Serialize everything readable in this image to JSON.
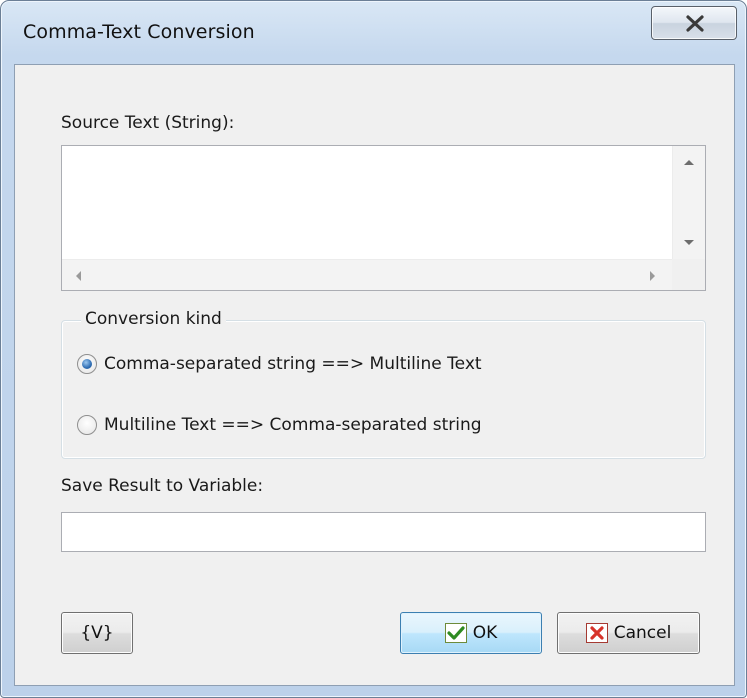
{
  "window": {
    "title": "Comma-Text Conversion",
    "close_glyph": "✕"
  },
  "source": {
    "label": "Source Text (String):",
    "value": ""
  },
  "conversion": {
    "legend": "Conversion kind",
    "options": [
      {
        "label": "Comma-separated string ==> Multiline Text",
        "selected": true
      },
      {
        "label": "Multiline Text ==> Comma-separated string",
        "selected": false
      }
    ]
  },
  "result": {
    "label": "Save Result to Variable:",
    "value": ""
  },
  "buttons": {
    "variables": "{V}",
    "ok": "OK",
    "cancel": "Cancel"
  },
  "icons": {
    "close": "close-icon",
    "ok": "checkmark-icon",
    "cancel": "x-icon",
    "scroll_up": "scroll-up-arrow-icon",
    "scroll_down": "scroll-down-arrow-icon",
    "scroll_left": "scroll-left-arrow-icon",
    "scroll_right": "scroll-right-arrow-icon"
  },
  "colors": {
    "frame": "#c5d8ee",
    "client": "#f0f0f0",
    "default_button": "#bee6fd",
    "check_green": "#2e8b22",
    "cancel_red": "#d7332a"
  }
}
